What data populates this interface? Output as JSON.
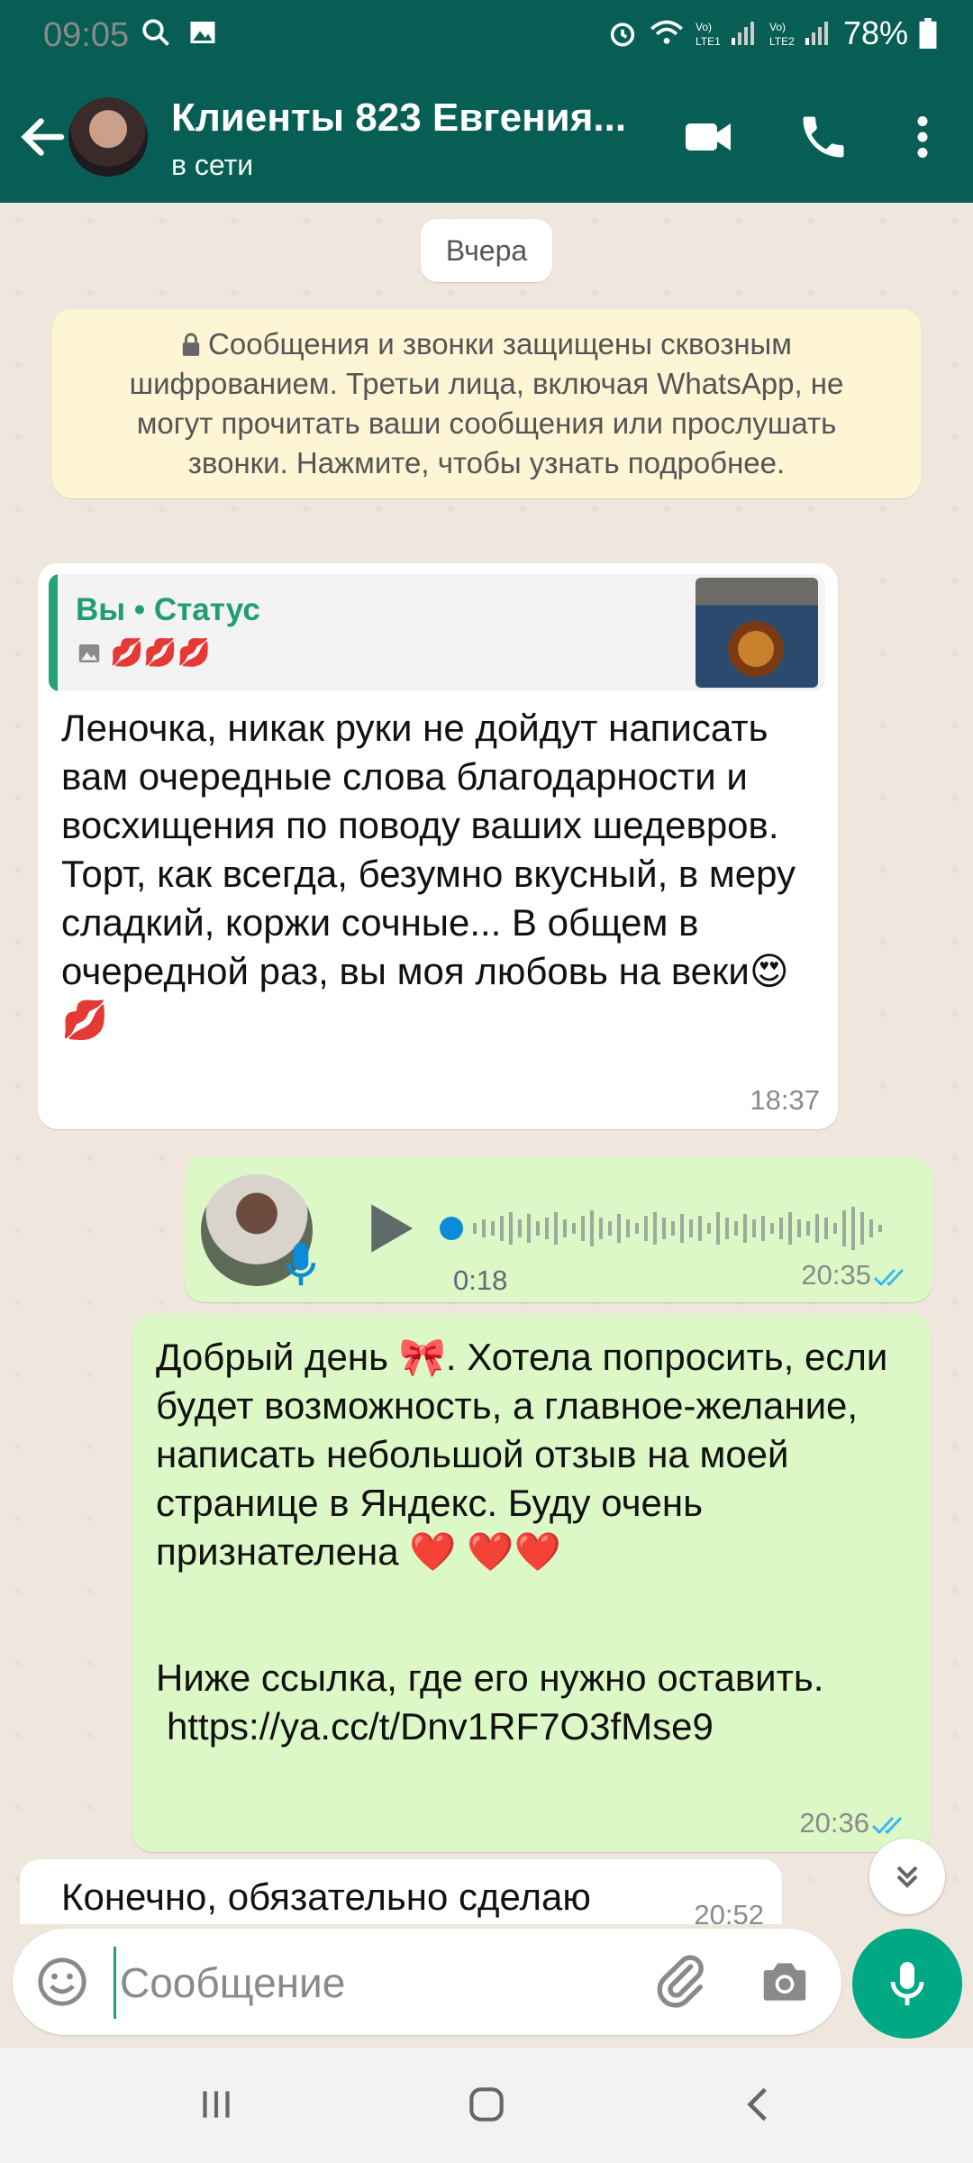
{
  "status_bar": {
    "time": "09:05",
    "battery": "78%"
  },
  "header": {
    "contact_name": "Клиенты 823 Евгения...",
    "status": "в сети"
  },
  "chat": {
    "date_label": "Вчера",
    "encryption_notice": "Сообщения и звонки защищены сквозным шифрованием. Третьи лица, включая WhatsApp, не могут прочитать ваши сообщения или прослушать звонки. Нажмите, чтобы узнать подробнее.",
    "messages": [
      {
        "direction": "in",
        "reply": {
          "author": "Вы • Статус",
          "preview": "💋💋💋"
        },
        "text": "Леночка, никак руки не дойдут написать вам очередные слова благодарности и восхищения по поводу ваших шедевров. Торт, как всегда, безумно вкусный, в меру сладкий, коржи сочные... В общем в очередной раз, вы моя любовь на веки😍💋",
        "time": "18:37"
      },
      {
        "direction": "out",
        "type": "voice",
        "duration": "0:18",
        "time": "20:35"
      },
      {
        "direction": "out",
        "line1": "Добрый день 🎀.  Хотела попросить, если будет возможность,  а главное-желание,  написать небольшой отзыв на моей странице в Яндекс.  Буду очень признателена ❤️ ❤️❤️",
        "line2": "Ниже ссылка, где его нужно оставить.",
        "link": "https://ya.cc/t/Dnv1RF7O3fMse9",
        "time": "20:36"
      },
      {
        "direction": "in",
        "text": "Конечно, обязательно сделаю",
        "time": "20:52"
      }
    ]
  },
  "composer": {
    "placeholder": "Сообщение"
  },
  "colors": {
    "header": "#075E54",
    "outgoing_bubble": "#DCF8C6",
    "accent": "#00A884",
    "link": "#0B7BC2"
  }
}
